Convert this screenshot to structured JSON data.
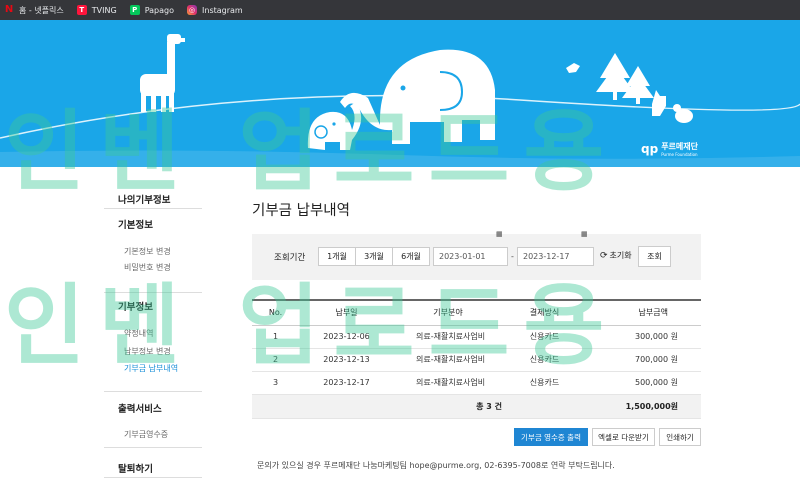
{
  "bookmarks": [
    {
      "icon": "netflix-icon",
      "label": "홈 - 넷플릭스"
    },
    {
      "icon": "tving-icon",
      "label": "TVING"
    },
    {
      "icon": "papago-icon",
      "label": "Papago"
    },
    {
      "icon": "instagram-icon",
      "label": "Instagram"
    }
  ],
  "banner": {
    "color": "#1aa6e8",
    "brand_name": "푸르메재단",
    "brand_sub": "Purme Foundation"
  },
  "sidebar": {
    "my_info": "나의기부정보",
    "basic": {
      "title": "기본정보",
      "items": [
        "기본정보 변경",
        "비밀번호 변경"
      ]
    },
    "donation": {
      "title": "기부정보",
      "items": [
        "약정내역",
        "납부정보 변경",
        "기부금 납부내역"
      ],
      "active_index": 2
    },
    "output": {
      "title": "출력서비스",
      "items": [
        "기부금영수증"
      ]
    },
    "withdraw": "탈퇴하기"
  },
  "page": {
    "title": "기부금 납부내역"
  },
  "filter": {
    "label": "조회기간",
    "periods": [
      "1개월",
      "3개월",
      "6개월"
    ],
    "date_from": "2023-01-01",
    "date_to": "2023-12-17",
    "reset": "초기화",
    "search": "조회"
  },
  "table": {
    "headers": [
      "No.",
      "납부일",
      "기부분야",
      "결제방식",
      "납부금액"
    ],
    "rows": [
      {
        "no": "1",
        "date": "2023-12-06",
        "field": "의료-재활치료사업비",
        "method": "신용카드",
        "amount": "300,000 원"
      },
      {
        "no": "2",
        "date": "2023-12-13",
        "field": "의료-재활치료사업비",
        "method": "신용카드",
        "amount": "700,000 원"
      },
      {
        "no": "3",
        "date": "2023-12-17",
        "field": "의료-재활치료사업비",
        "method": "신용카드",
        "amount": "500,000 원"
      }
    ],
    "total_label": "총 3 건",
    "total_amount": "1,500,000원"
  },
  "actions": {
    "print_receipt": "기부금 영수증 출력",
    "excel": "엑셀로 다운받기",
    "print": "인쇄하기"
  },
  "notice": "문의가 있으실 경우 푸르메재단 나눔마케팅팀 hope@purme.org, 02-6395-7008로 연락 부탁드립니다.",
  "watermark": [
    "인벤 업로드용",
    "인벤 업로드용"
  ]
}
